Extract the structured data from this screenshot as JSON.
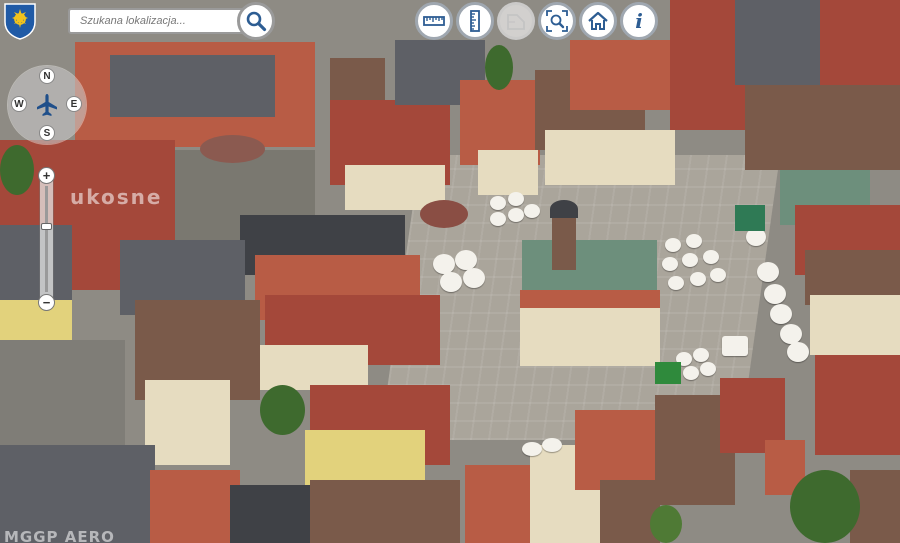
{
  "search": {
    "placeholder": "Szukana lokalizacja..."
  },
  "toolbar": {
    "tools": [
      {
        "name": "measure-distance",
        "icon": "ruler-horizontal-icon",
        "enabled": true
      },
      {
        "name": "measure-height",
        "icon": "ruler-vertical-icon",
        "enabled": true
      },
      {
        "name": "measure-area",
        "icon": "area-measure-icon",
        "enabled": false
      },
      {
        "name": "zoom-extent",
        "icon": "zoom-extent-icon",
        "enabled": true
      },
      {
        "name": "home",
        "icon": "home-icon",
        "enabled": true
      },
      {
        "name": "info",
        "icon": "info-icon",
        "enabled": true
      }
    ],
    "info_glyph": "i"
  },
  "compass": {
    "north": "N",
    "south": "S",
    "west": "W",
    "east": "E"
  },
  "zoom": {
    "in_label": "+",
    "out_label": "−",
    "level": 0.63
  },
  "watermarks": {
    "oblique": "ukosne",
    "provider": "MGGP AERO"
  },
  "colors": {
    "tool_icon": "#2d5d93",
    "tool_border": "#9fa7b0",
    "crest_blue": "#1f5aa6",
    "crest_gold": "#f0c21d"
  }
}
